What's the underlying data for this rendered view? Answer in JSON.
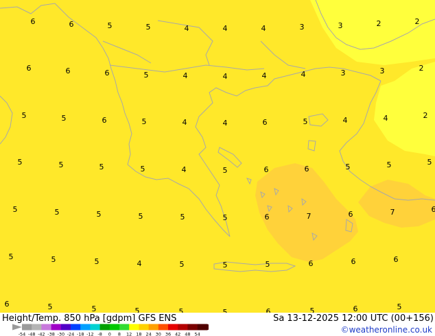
{
  "footer": {
    "title": "Height/Temp. 850 hPa [gdpm] GFS ENS",
    "valid_time": "Sa 13-12-2025 12:00 UTC (00+156)",
    "credit": "©weatheronline.co.uk"
  },
  "colorbar": {
    "ticks": [
      "-54",
      "-48",
      "-42",
      "-38",
      "-30",
      "-24",
      "-18",
      "-12",
      "-8",
      "0",
      "8",
      "12",
      "18",
      "24",
      "30",
      "36",
      "42",
      "48",
      "54"
    ],
    "colors": [
      "#9a9a9a",
      "#b4b4b4",
      "#c878dc",
      "#a000c8",
      "#5000c8",
      "#0040ff",
      "#00a0ff",
      "#00d2d2",
      "#00a000",
      "#00c800",
      "#32dc32",
      "#ffff00",
      "#ffd200",
      "#ffa000",
      "#ff5000",
      "#e60000",
      "#b40000",
      "#7a0000",
      "#500000"
    ]
  },
  "map_colors": {
    "base": "#ffe82a",
    "light": "#ffff3c",
    "warm": "#ffd23a",
    "outline": "#a8a8a8"
  },
  "labels": [
    {
      "v": "6"
    },
    {
      "v": "6"
    },
    {
      "v": "5"
    },
    {
      "v": "5"
    },
    {
      "v": "4"
    },
    {
      "v": "4"
    },
    {
      "v": "4"
    },
    {
      "v": "3"
    },
    {
      "v": "3"
    },
    {
      "v": "2"
    },
    {
      "v": "2"
    },
    {
      "v": "6"
    },
    {
      "v": "6"
    },
    {
      "v": "6"
    },
    {
      "v": "5"
    },
    {
      "v": "4"
    },
    {
      "v": "4"
    },
    {
      "v": "4"
    },
    {
      "v": "4"
    },
    {
      "v": "3"
    },
    {
      "v": "3"
    },
    {
      "v": "2"
    },
    {
      "v": "5"
    },
    {
      "v": "5"
    },
    {
      "v": "6"
    },
    {
      "v": "5"
    },
    {
      "v": "4"
    },
    {
      "v": "4"
    },
    {
      "v": "6"
    },
    {
      "v": "5"
    },
    {
      "v": "4"
    },
    {
      "v": "4"
    },
    {
      "v": "2"
    },
    {
      "v": "5"
    },
    {
      "v": "5"
    },
    {
      "v": "5"
    },
    {
      "v": "5"
    },
    {
      "v": "4"
    },
    {
      "v": "5"
    },
    {
      "v": "6"
    },
    {
      "v": "6"
    },
    {
      "v": "5"
    },
    {
      "v": "5"
    },
    {
      "v": "5"
    },
    {
      "v": "5"
    },
    {
      "v": "5"
    },
    {
      "v": "5"
    },
    {
      "v": "5"
    },
    {
      "v": "5"
    },
    {
      "v": "5"
    },
    {
      "v": "6"
    },
    {
      "v": "7"
    },
    {
      "v": "6"
    },
    {
      "v": "7"
    },
    {
      "v": "6"
    },
    {
      "v": "5"
    },
    {
      "v": "5"
    },
    {
      "v": "5"
    },
    {
      "v": "4"
    },
    {
      "v": "5"
    },
    {
      "v": "5"
    },
    {
      "v": "5"
    },
    {
      "v": "6"
    },
    {
      "v": "6"
    },
    {
      "v": "6"
    },
    {
      "v": "6"
    },
    {
      "v": "5"
    },
    {
      "v": "5"
    },
    {
      "v": "5"
    },
    {
      "v": "5"
    },
    {
      "v": "5"
    },
    {
      "v": "6"
    },
    {
      "v": "5"
    },
    {
      "v": "6"
    },
    {
      "v": "5"
    }
  ]
}
